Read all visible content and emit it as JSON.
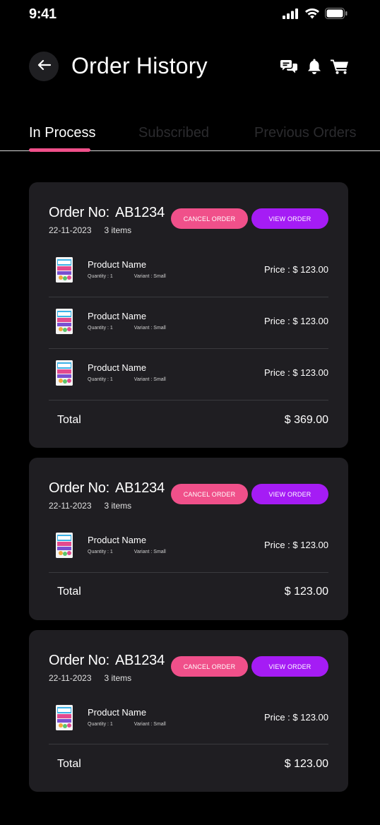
{
  "status_bar": {
    "time": "9:41"
  },
  "header": {
    "title": "Order History"
  },
  "tabs": [
    {
      "label": "In Process",
      "active": true
    },
    {
      "label": "Subscribed",
      "active": false
    },
    {
      "label": "Previous Orders",
      "active": false
    }
  ],
  "labels": {
    "order_no": "Order No:",
    "cancel": "CANCEL ORDER",
    "view": "VIEW ORDER",
    "total": "Total"
  },
  "orders": [
    {
      "id": "AB1234",
      "date": "22-11-2023",
      "items_count": "3 items",
      "items": [
        {
          "name": "Product Name",
          "quantity": "Quantity : 1",
          "variant": "Variant : Small",
          "price": "Price : $ 123.00"
        },
        {
          "name": "Product Name",
          "quantity": "Quantity : 1",
          "variant": "Variant : Small",
          "price": "Price : $ 123.00"
        },
        {
          "name": "Product Name",
          "quantity": "Quantity : 1",
          "variant": "Variant : Small",
          "price": "Price : $ 123.00"
        }
      ],
      "total": "$ 369.00"
    },
    {
      "id": "AB1234",
      "date": "22-11-2023",
      "items_count": "3 items",
      "items": [
        {
          "name": "Product Name",
          "quantity": "Quantity : 1",
          "variant": "Variant : Small",
          "price": "Price : $ 123.00"
        }
      ],
      "total": "$ 123.00"
    },
    {
      "id": "AB1234",
      "date": "22-11-2023",
      "items_count": "3 items",
      "items": [
        {
          "name": "Product Name",
          "quantity": "Quantity : 1",
          "variant": "Variant : Small",
          "price": "Price : $ 123.00"
        }
      ],
      "total": "$ 123.00"
    }
  ],
  "colors": {
    "background": "#000000",
    "card": "#1f1e22",
    "accent_pink": "#f0508a",
    "accent_purple": "#a51cf5",
    "inactive_tab": "#2b2b2e"
  },
  "icons": {
    "back": "arrow-left-icon",
    "chat": "chat-bubbles-icon",
    "notifications": "bell-icon",
    "cart": "cart-icon",
    "signal": "signal-icon",
    "wifi": "wifi-icon",
    "battery": "battery-icon"
  }
}
